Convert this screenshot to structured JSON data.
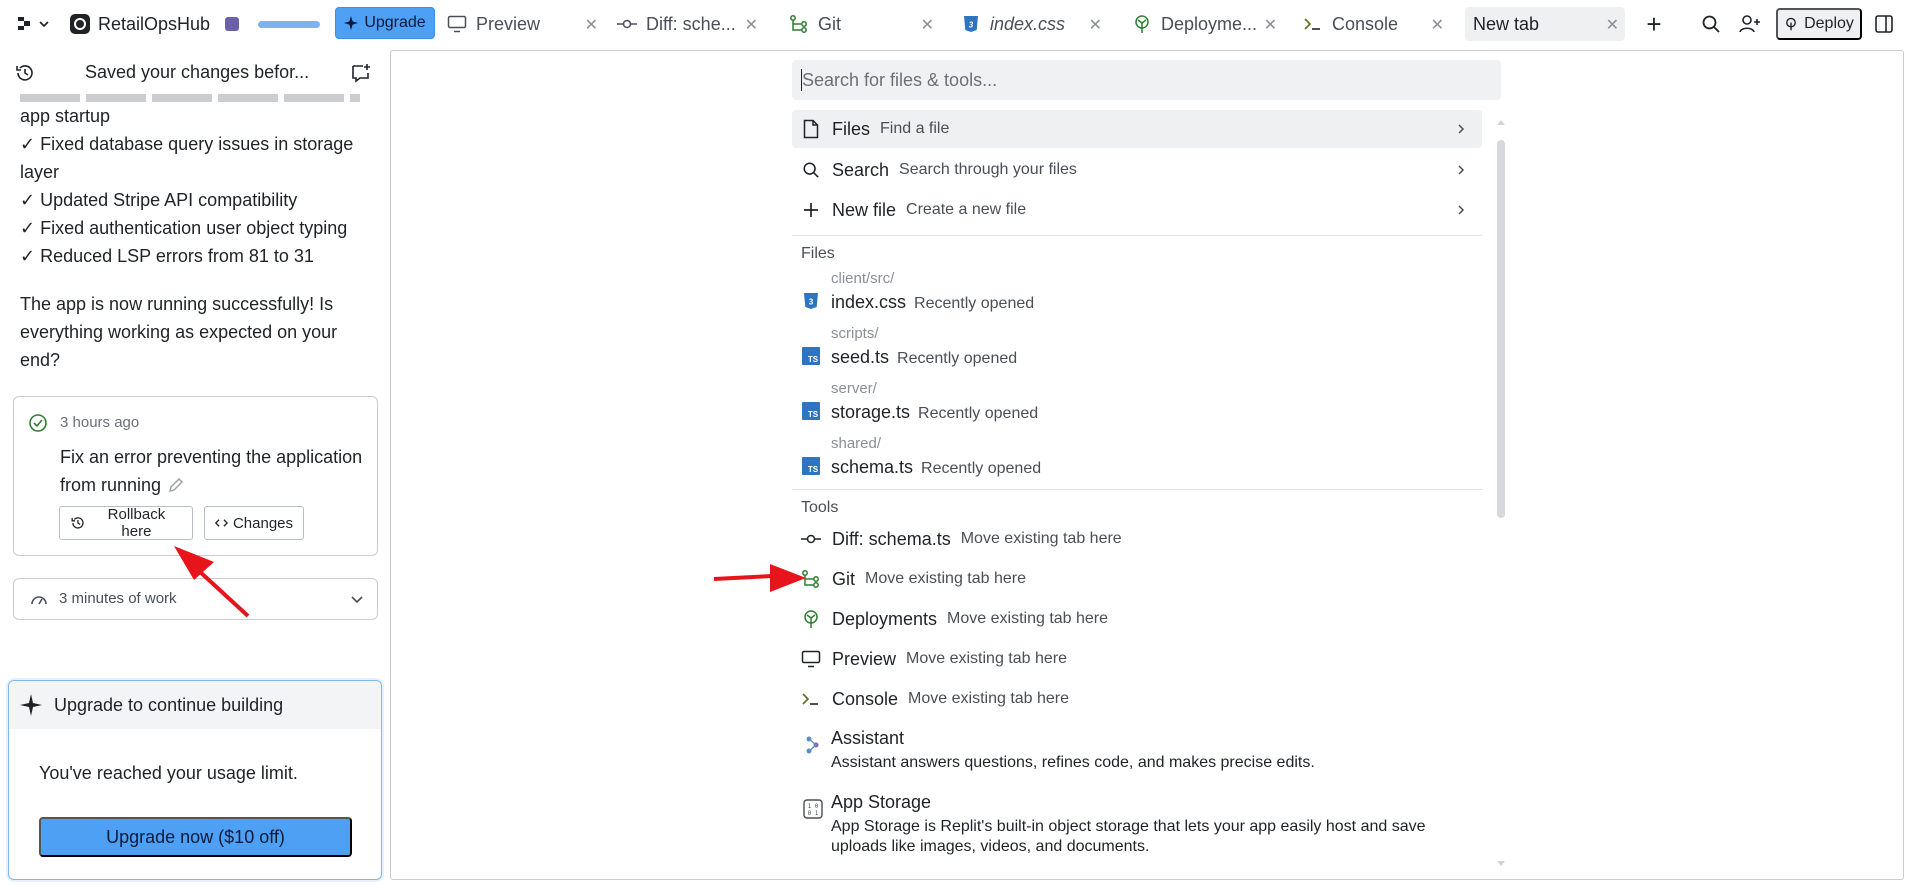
{
  "project": {
    "name": "RetailOpsHub"
  },
  "topbar": {
    "upgrade_label": "Upgrade",
    "usage_progress_percent": 100,
    "tabs": [
      {
        "label": "Preview",
        "icon": "monitor-icon"
      },
      {
        "label": "Diff: sche...",
        "icon": "git-commit-icon"
      },
      {
        "label": "Git",
        "icon": "git-branch-icon"
      },
      {
        "label": "index.css",
        "icon": "css-file-icon"
      },
      {
        "label": "Deployme...",
        "icon": "deployments-icon"
      },
      {
        "label": "Console",
        "icon": "terminal-icon"
      },
      {
        "label": "New tab",
        "icon": ""
      }
    ],
    "deploy_label": "Deploy"
  },
  "sidebar": {
    "title": "Saved your changes befor...",
    "messages": [
      "app startup",
      "✓ Fixed database query issues in storage",
      "layer",
      "✓ Updated Stripe API compatibility",
      "✓ Fixed authentication user object typing",
      "✓ Reduced LSP errors from 81 to 31"
    ],
    "closing_message": "The app is now running successfully! Is everything working as expected on your end?",
    "checkpoint": {
      "time": "3 hours ago",
      "title": "Fix an error preventing the application from running",
      "rollback_label": "Rollback here",
      "changes_label": "Changes"
    },
    "work": {
      "label": "3 minutes of work"
    },
    "upgrade_card": {
      "title": "Upgrade to continue building",
      "body": "You've reached your usage limit.",
      "button": "Upgrade now ($10 off)"
    }
  },
  "palette": {
    "search_placeholder": "Search for files & tools...",
    "actions": [
      {
        "name": "Files",
        "desc": "Find a file",
        "icon": "file-icon"
      },
      {
        "name": "Search",
        "desc": "Search through your files",
        "icon": "search-icon"
      },
      {
        "name": "New file",
        "desc": "Create a new file",
        "icon": "plus-icon"
      }
    ],
    "files_heading": "Files",
    "files": [
      {
        "path": "client/src/",
        "name": "index.css",
        "desc": "Recently opened",
        "icon": "css-file-icon"
      },
      {
        "path": "scripts/",
        "name": "seed.ts",
        "desc": "Recently opened",
        "icon": "ts-file-icon"
      },
      {
        "path": "server/",
        "name": "storage.ts",
        "desc": "Recently opened",
        "icon": "ts-file-icon"
      },
      {
        "path": "shared/",
        "name": "schema.ts",
        "desc": "Recently opened",
        "icon": "ts-file-icon"
      }
    ],
    "tools_heading": "Tools",
    "tools": [
      {
        "name": "Diff: schema.ts",
        "desc": "Move existing tab here",
        "icon": "git-commit-icon"
      },
      {
        "name": "Git",
        "desc": "Move existing tab here",
        "icon": "git-branch-icon"
      },
      {
        "name": "Deployments",
        "desc": "Move existing tab here",
        "icon": "deployments-icon"
      },
      {
        "name": "Preview",
        "desc": "Move existing tab here",
        "icon": "monitor-icon"
      },
      {
        "name": "Console",
        "desc": "Move existing tab here",
        "icon": "terminal-icon"
      }
    ],
    "extra_tools": [
      {
        "name": "Assistant",
        "desc": "Assistant answers questions, refines code, and makes precise edits.",
        "icon": "assistant-icon"
      },
      {
        "name": "App Storage",
        "desc": "App Storage is Replit's built-in object storage that lets your app easily host and save uploads like images, videos, and documents.",
        "icon": "storage-icon"
      }
    ]
  },
  "colors": {
    "accent": "#4ea0f5",
    "annotation_arrow": "#e8141b",
    "git_green": "#2f7d32",
    "ts_blue": "#2f74c0"
  }
}
